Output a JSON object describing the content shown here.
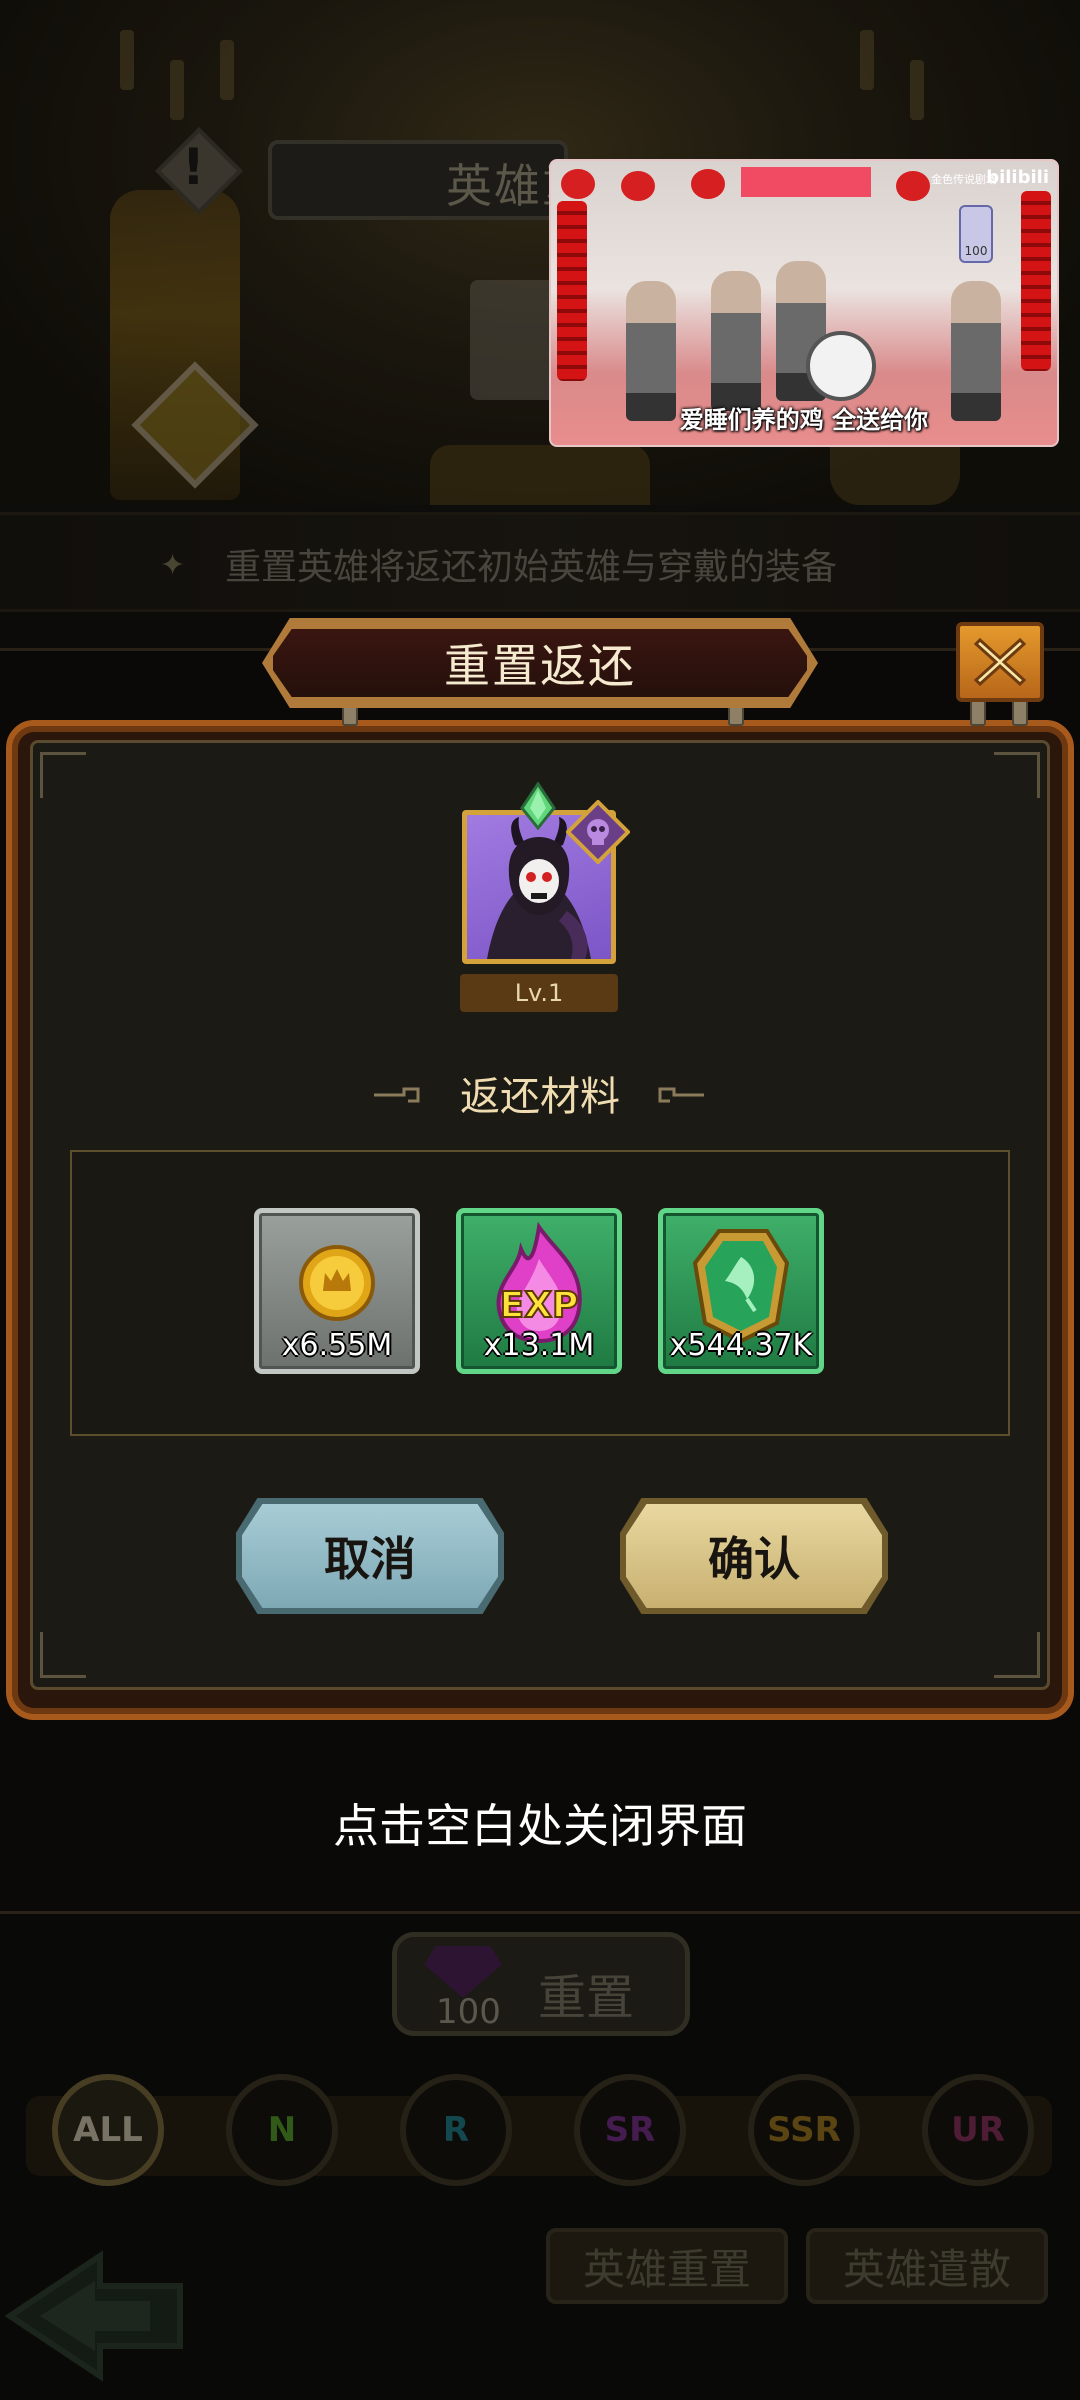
{
  "background": {
    "screen_title": "英雄重",
    "notice": "重置英雄将返还初始英雄与穿戴的装备",
    "reset_button": {
      "label": "重置",
      "gem_cost": "100"
    },
    "filters": [
      {
        "label": "ALL",
        "color": "#b9b09a"
      },
      {
        "label": "N",
        "color": "#4c8a26"
      },
      {
        "label": "R",
        "color": "#1f6f7a"
      },
      {
        "label": "SR",
        "color": "#6a2b7a"
      },
      {
        "label": "SSR",
        "color": "#8a6a1c"
      },
      {
        "label": "UR",
        "color": "#7a2b52"
      }
    ],
    "tabs": [
      "英雄重置",
      "英雄遣散"
    ]
  },
  "video": {
    "caption": "爱睡们养的鸡 全送给你",
    "logo": "bilibili",
    "watermark": "金色传说剧场",
    "badge": "100"
  },
  "dialog": {
    "title": "重置返还",
    "hero": {
      "level": "Lv.1"
    },
    "materials_title": "返还材料",
    "materials": [
      {
        "name": "gold-coin",
        "amount": "x6.55M",
        "frame": "gray"
      },
      {
        "name": "exp-flame",
        "amount": "x13.1M",
        "frame": "green"
      },
      {
        "name": "green-stone",
        "amount": "x544.37K",
        "frame": "green"
      }
    ],
    "cancel_label": "取消",
    "confirm_label": "确认",
    "close_hint": "点击空白处关闭界面"
  },
  "colors": {
    "panel_border": "#a85a1c",
    "cancel_button": "#a8ccd6",
    "confirm_button": "#e8d8a0",
    "close_button": "#e49a2c"
  }
}
